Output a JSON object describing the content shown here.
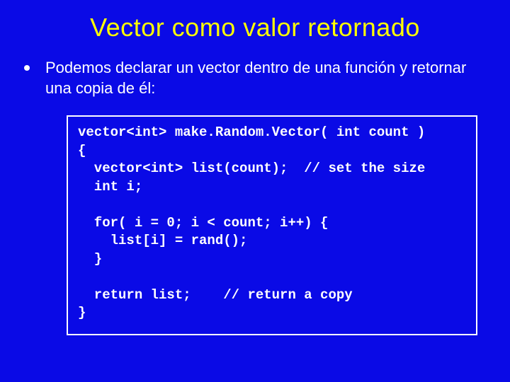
{
  "title": "Vector como valor retornado",
  "bullet_text": "Podemos declarar un vector dentro de una función y retornar una copia de él:",
  "code": {
    "l1": "vector<int> make.Random.Vector( int count )",
    "l2": "{",
    "l3": "  vector<int> list(count);  // set the size",
    "l4": "  int i;",
    "l5": "  for( i = 0; i < count; i++) {",
    "l6": "    list[i] = rand();",
    "l7": "  }",
    "l8": "  return list;    // return a copy",
    "l9": "}"
  }
}
